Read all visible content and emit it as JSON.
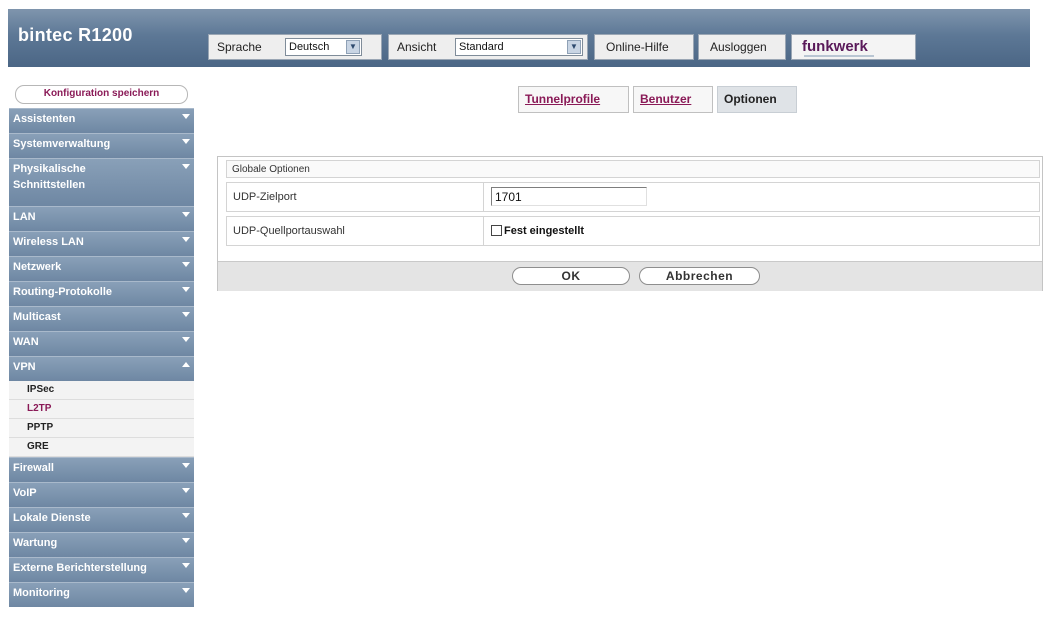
{
  "app": {
    "title": "bintec R1200"
  },
  "header": {
    "language_label": "Sprache",
    "language_value": "Deutsch",
    "view_label": "Ansicht",
    "view_value": "Standard",
    "help_label": "Online-Hilfe",
    "logout_label": "Ausloggen",
    "logo_text": "funkwerk"
  },
  "sidebar": {
    "save_label": "Konfiguration speichern",
    "items": [
      {
        "label": "Assistenten"
      },
      {
        "label": "Systemverwaltung"
      },
      {
        "label": "Physikalische",
        "label2": "Schnittstellen"
      },
      {
        "label": "LAN"
      },
      {
        "label": "Wireless LAN"
      },
      {
        "label": "Netzwerk"
      },
      {
        "label": "Routing-Protokolle"
      },
      {
        "label": "Multicast"
      },
      {
        "label": "WAN"
      },
      {
        "label": "VPN"
      },
      {
        "label": "Firewall"
      },
      {
        "label": "VoIP"
      },
      {
        "label": "Lokale Dienste"
      },
      {
        "label": "Wartung"
      },
      {
        "label": "Externe Berichterstellung"
      },
      {
        "label": "Monitoring"
      }
    ],
    "vpn_sub": [
      "IPSec",
      "L2TP",
      "PPTP",
      "GRE"
    ]
  },
  "tabs": [
    {
      "label": "Tunnelprofile"
    },
    {
      "label": "Benutzer"
    },
    {
      "label": "Optionen"
    }
  ],
  "main": {
    "section_title": "Globale Optionen",
    "udp_dest_label": "UDP-Zielport",
    "udp_dest_value": "1701",
    "udp_src_label": "UDP-Quellportauswahl",
    "udp_src_checkbox_label": "Fest eingestellt",
    "ok_label": "OK",
    "cancel_label": "Abbrechen"
  }
}
